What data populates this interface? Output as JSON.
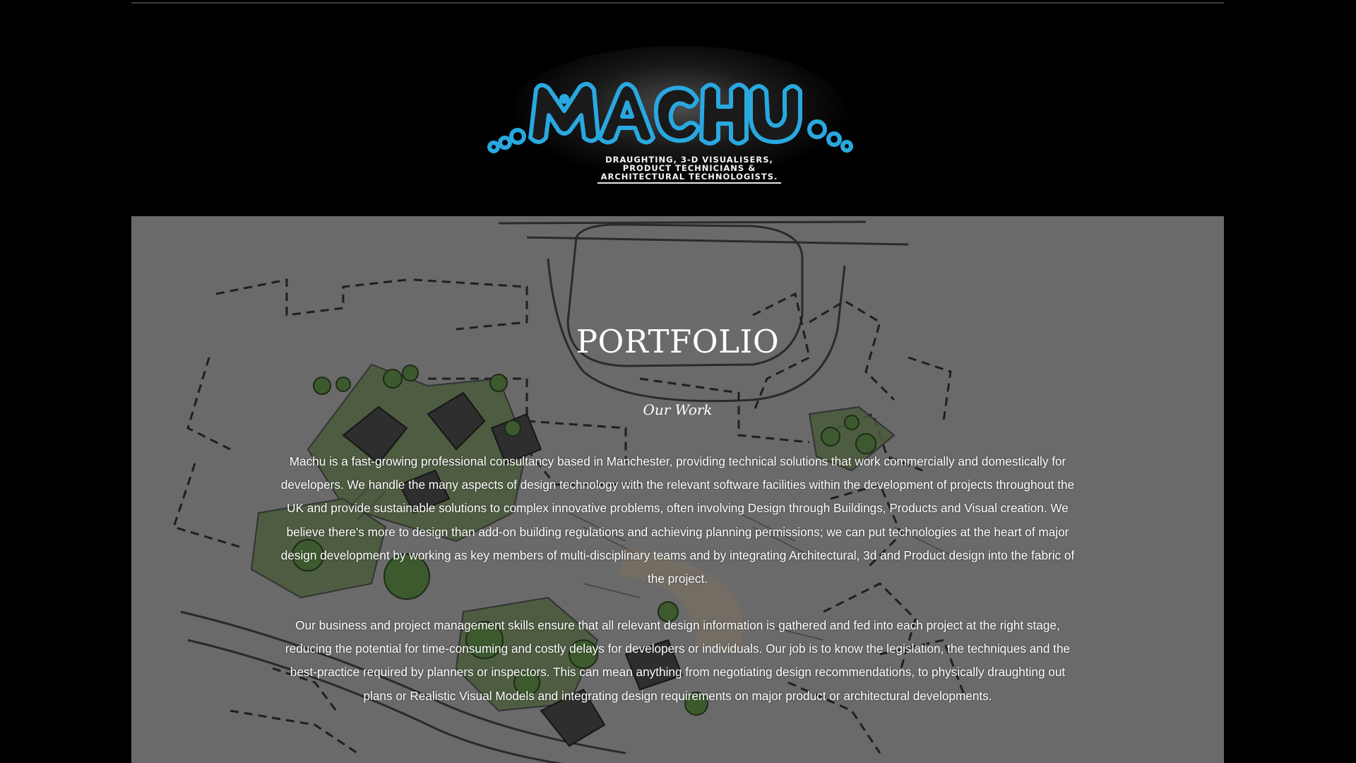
{
  "logo": {
    "wordmark": "MACHU",
    "tagline": "Draughting, 3-D Visualisers, Product Technicians & Architectural Technologists."
  },
  "main": {
    "title": "PORTFOLIO",
    "subtitle": "Our Work",
    "paragraphs": [
      "Machu is a fast-growing professional consultancy based in Manchester, providing technical solutions that work commercially and domestically for developers.  We handle the many aspects of design technology with the relevant software facilities within the development of projects throughout the UK and provide sustainable solutions to complex innovative problems, often involving Design through Buildings, Products and Visual creation.  We believe there's more to design than add-on building regulations and achieving planning permissions; we can put technologies at the heart of major design development by working as key members of multi-disciplinary teams and by integrating Architectural, 3d and Product design into the fabric of the project.",
      "Our business and project management skills ensure that all relevant design information is gathered and fed into each project at the right stage, reducing the potential for time-consuming and costly delays for developers or individuals.  Our job is to know the legislation, the techniques and the best-practice required by planners or inspectors.  This can mean anything from negotiating design recommendations, to physically draughting out plans or Realistic Visual Models and integrating design requirements on major product or architectural developments."
    ]
  },
  "colors": {
    "page_background": "#000000",
    "content_background": "#6a6a6a",
    "logo_accent": "#29a8e0",
    "text": "#ffffff"
  }
}
